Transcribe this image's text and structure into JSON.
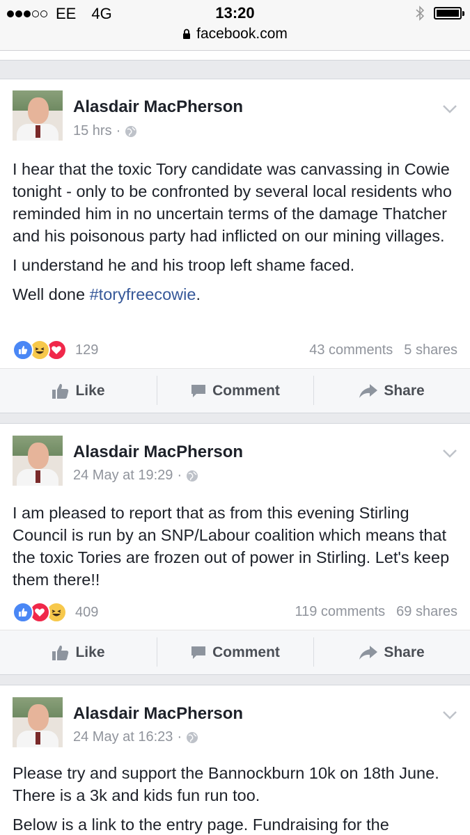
{
  "status_bar": {
    "carrier": "EE",
    "network": "4G",
    "time": "13:20",
    "signal_bars": 3,
    "signal_total": 5
  },
  "browser": {
    "url": "facebook.com"
  },
  "colors": {
    "link": "#365899",
    "meta": "#90949c",
    "like_blue": "#4a87f5",
    "love_red": "#f0284a",
    "haha_yellow": "#f7c84b"
  },
  "actions": {
    "like": "Like",
    "comment": "Comment",
    "share": "Share"
  },
  "posts": [
    {
      "author": "Alasdair MacPherson",
      "time": "15 hrs",
      "paragraphs": [
        "I hear that the toxic Tory candidate was canvassing in Cowie tonight - only to be confronted by several local residents who reminded him in no uncertain terms of the damage Thatcher and his poisonous party had inflicted on our mining villages.",
        "I understand he and his troop left shame faced."
      ],
      "last_line_prefix": "Well done ",
      "hashtag": "#toryfreecowie",
      "last_line_suffix": ".",
      "reaction_icons": [
        "like-icon",
        "haha-icon",
        "love-icon"
      ],
      "reaction_count": "129",
      "comments": "43 comments",
      "shares": "5 shares"
    },
    {
      "author": "Alasdair MacPherson",
      "time": "24 May at 19:29",
      "paragraphs": [
        "I am pleased to report that as from this evening Stirling Council is run by an SNP/Labour coalition which means that the toxic Tories are frozen out of power in Stirling. Let's keep them there!!"
      ],
      "reaction_icons": [
        "like-icon",
        "love-icon",
        "haha-icon"
      ],
      "reaction_count": "409",
      "comments": "119 comments",
      "shares": "69 shares"
    },
    {
      "author": "Alasdair MacPherson",
      "time": "24 May at 16:23",
      "paragraphs": [
        "Please try and support the Bannockburn 10k on 18th June. There is a 3k and kids fun run too.",
        "Below is a link to the entry page. Fundraising for the"
      ]
    }
  ]
}
